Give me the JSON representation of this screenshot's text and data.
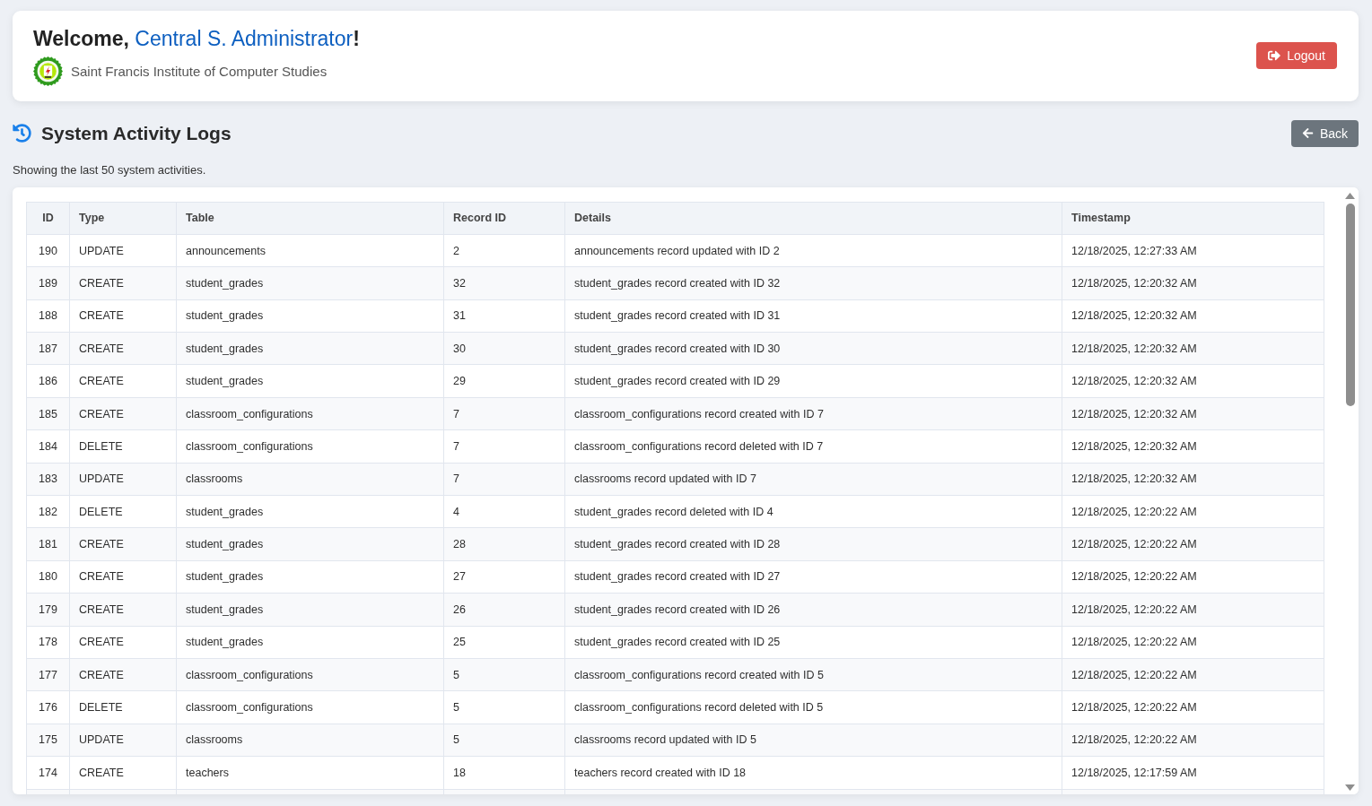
{
  "header": {
    "greeting": "Welcome,",
    "user_name": "Central S. Administrator",
    "exclamation": "!",
    "institution": "Saint Francis Institute of Computer Studies",
    "logout_button": "Logout"
  },
  "page": {
    "title": "System Activity Logs",
    "back_button": "Back",
    "subtitle": "Showing the last 50 system activities."
  },
  "table": {
    "columns": [
      "ID",
      "Type",
      "Table",
      "Record ID",
      "Details",
      "Timestamp"
    ],
    "rows": [
      {
        "id": "190",
        "type": "UPDATE",
        "table": "announcements",
        "record_id": "2",
        "details": "announcements record updated with ID 2",
        "timestamp": "12/18/2025, 12:27:33 AM"
      },
      {
        "id": "189",
        "type": "CREATE",
        "table": "student_grades",
        "record_id": "32",
        "details": "student_grades record created with ID 32",
        "timestamp": "12/18/2025, 12:20:32 AM"
      },
      {
        "id": "188",
        "type": "CREATE",
        "table": "student_grades",
        "record_id": "31",
        "details": "student_grades record created with ID 31",
        "timestamp": "12/18/2025, 12:20:32 AM"
      },
      {
        "id": "187",
        "type": "CREATE",
        "table": "student_grades",
        "record_id": "30",
        "details": "student_grades record created with ID 30",
        "timestamp": "12/18/2025, 12:20:32 AM"
      },
      {
        "id": "186",
        "type": "CREATE",
        "table": "student_grades",
        "record_id": "29",
        "details": "student_grades record created with ID 29",
        "timestamp": "12/18/2025, 12:20:32 AM"
      },
      {
        "id": "185",
        "type": "CREATE",
        "table": "classroom_configurations",
        "record_id": "7",
        "details": "classroom_configurations record created with ID 7",
        "timestamp": "12/18/2025, 12:20:32 AM"
      },
      {
        "id": "184",
        "type": "DELETE",
        "table": "classroom_configurations",
        "record_id": "7",
        "details": "classroom_configurations record deleted with ID 7",
        "timestamp": "12/18/2025, 12:20:32 AM"
      },
      {
        "id": "183",
        "type": "UPDATE",
        "table": "classrooms",
        "record_id": "7",
        "details": "classrooms record updated with ID 7",
        "timestamp": "12/18/2025, 12:20:32 AM"
      },
      {
        "id": "182",
        "type": "DELETE",
        "table": "student_grades",
        "record_id": "4",
        "details": "student_grades record deleted with ID 4",
        "timestamp": "12/18/2025, 12:20:22 AM"
      },
      {
        "id": "181",
        "type": "CREATE",
        "table": "student_grades",
        "record_id": "28",
        "details": "student_grades record created with ID 28",
        "timestamp": "12/18/2025, 12:20:22 AM"
      },
      {
        "id": "180",
        "type": "CREATE",
        "table": "student_grades",
        "record_id": "27",
        "details": "student_grades record created with ID 27",
        "timestamp": "12/18/2025, 12:20:22 AM"
      },
      {
        "id": "179",
        "type": "CREATE",
        "table": "student_grades",
        "record_id": "26",
        "details": "student_grades record created with ID 26",
        "timestamp": "12/18/2025, 12:20:22 AM"
      },
      {
        "id": "178",
        "type": "CREATE",
        "table": "student_grades",
        "record_id": "25",
        "details": "student_grades record created with ID 25",
        "timestamp": "12/18/2025, 12:20:22 AM"
      },
      {
        "id": "177",
        "type": "CREATE",
        "table": "classroom_configurations",
        "record_id": "5",
        "details": "classroom_configurations record created with ID 5",
        "timestamp": "12/18/2025, 12:20:22 AM"
      },
      {
        "id": "176",
        "type": "DELETE",
        "table": "classroom_configurations",
        "record_id": "5",
        "details": "classroom_configurations record deleted with ID 5",
        "timestamp": "12/18/2025, 12:20:22 AM"
      },
      {
        "id": "175",
        "type": "UPDATE",
        "table": "classrooms",
        "record_id": "5",
        "details": "classrooms record updated with ID 5",
        "timestamp": "12/18/2025, 12:20:22 AM"
      },
      {
        "id": "174",
        "type": "CREATE",
        "table": "teachers",
        "record_id": "18",
        "details": "teachers record created with ID 18",
        "timestamp": "12/18/2025, 12:17:59 AM"
      }
    ]
  }
}
